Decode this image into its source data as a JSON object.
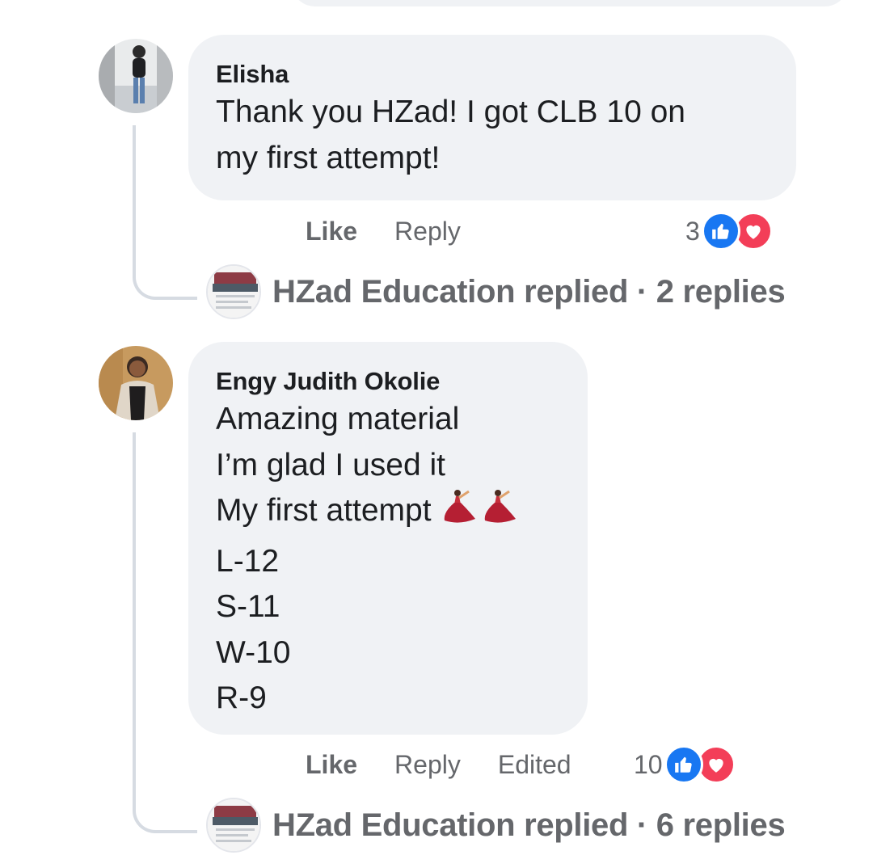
{
  "comments": [
    {
      "author": "Elisha",
      "lines": [
        "Thank you HZad! I got CLB 10 on",
        "my first attempt!"
      ],
      "actions": {
        "like": "Like",
        "reply": "Reply"
      },
      "reaction_count": "3",
      "reactions": [
        "like-icon",
        "love-icon"
      ],
      "replied": "HZad Education replied · 2 replies"
    },
    {
      "author": "Engy Judith Okolie",
      "lines": [
        "Amazing material",
        "I’m glad I used it",
        "My first attempt",
        "L-12",
        "S-11",
        "W-10",
        "R-9"
      ],
      "emoji": "💃💃",
      "actions": {
        "like": "Like",
        "reply": "Reply",
        "edited": "Edited"
      },
      "reaction_count": "10",
      "reactions": [
        "like-icon",
        "love-icon"
      ],
      "replied": "HZad Education replied · 6 replies"
    }
  ],
  "colors": {
    "bubble": "#f0f2f5",
    "like": "#1877f2",
    "love": "#f33e58",
    "meta_text": "#65676b"
  }
}
